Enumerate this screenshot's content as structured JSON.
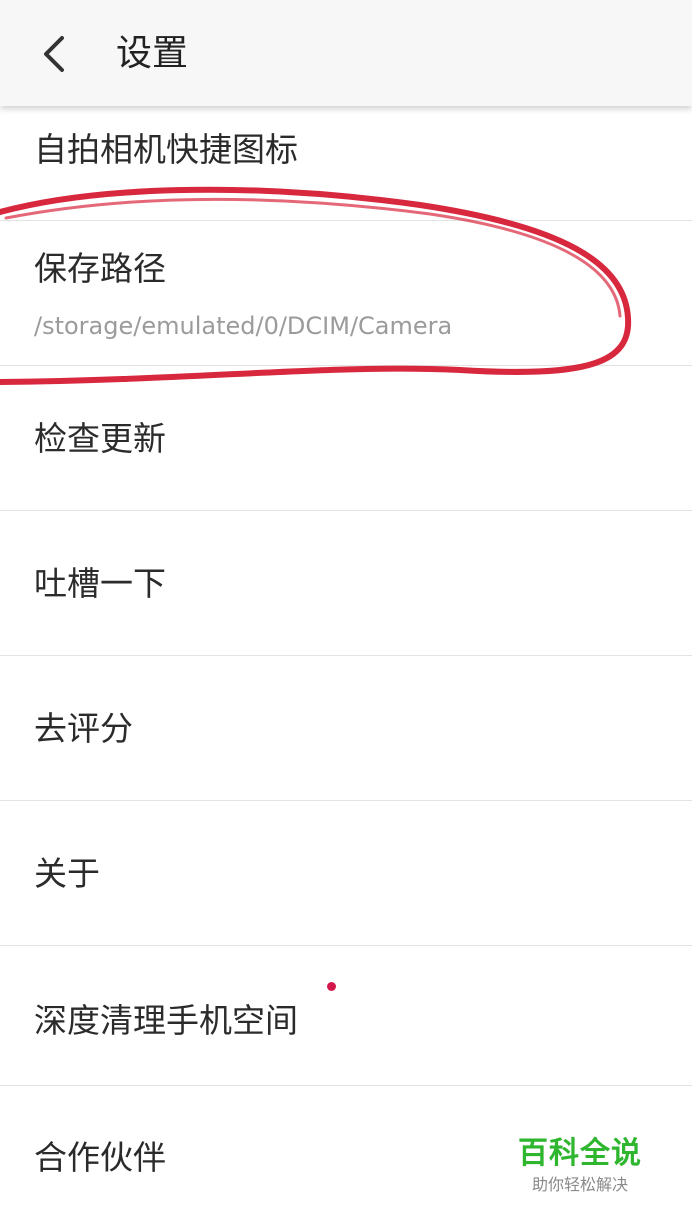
{
  "header": {
    "back_icon": "chevron-left-icon",
    "title": "设置"
  },
  "settings": {
    "selfie_shortcut": {
      "label": "自拍相机快捷图标"
    },
    "save_path": {
      "label": "保存路径",
      "value": "/storage/emulated/0/DCIM/Camera"
    },
    "check_update": {
      "label": "检查更新"
    },
    "feedback": {
      "label": "吐槽一下"
    },
    "rate": {
      "label": "去评分"
    },
    "about": {
      "label": "关于"
    },
    "deep_clean": {
      "label": "深度清理手机空间",
      "badge_color": "#d4174a"
    },
    "partners": {
      "label": "合作伙伴"
    }
  },
  "annotation": {
    "color": "#d8283e"
  },
  "watermark": {
    "main": "百科全说",
    "sub": "助你轻松解决",
    "color": "#2fb62f"
  }
}
